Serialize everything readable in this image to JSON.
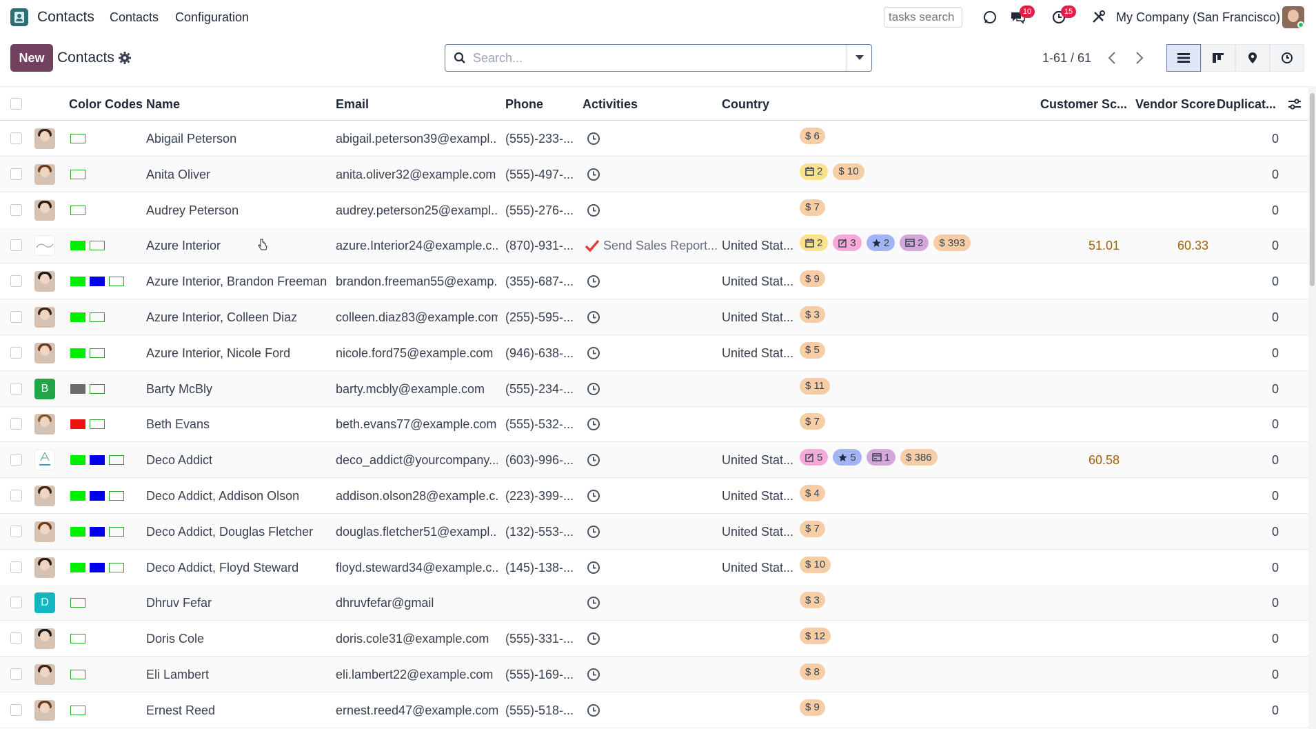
{
  "navbar": {
    "app_title": "Contacts",
    "menu": [
      "Contacts",
      "Configuration"
    ],
    "tasks_search_placeholder": "tasks search",
    "messages_badge": "10",
    "activities_badge": "15",
    "company": "My Company (San Francisco)"
  },
  "control_panel": {
    "new_label": "New",
    "breadcrumb": "Contacts",
    "search_placeholder": "Search...",
    "pager": "1-61 / 61"
  },
  "columns": {
    "color_codes": "Color Codes",
    "name": "Name",
    "email": "Email",
    "phone": "Phone",
    "activities": "Activities",
    "country": "Country",
    "customer_score": "Customer Sc...",
    "vendor_score": "Vendor Score",
    "duplicates": "Duplicat..."
  },
  "colors": {
    "green": "#00ee00",
    "blue": "#0000ee",
    "gray": "#6b6b6b",
    "red": "#ee1111",
    "brand": "#71415f",
    "tag_sales": "#f6cda4",
    "tag_meeting": "#fbe28a",
    "tag_task": "#f7a9d8",
    "tag_star": "#a3b4f5",
    "tag_invoice": "#d4a7d8"
  },
  "rows": [
    {
      "name": "Abigail Peterson",
      "email": "abigail.peterson39@exampl...",
      "phone": "(555)-233-...",
      "country": "",
      "activity": "",
      "swatches": [
        "empty"
      ],
      "avatar": "photo",
      "tags": [
        {
          "kind": "sales",
          "text": "$ 6"
        }
      ],
      "customer_score": "",
      "vendor_score": "",
      "duplicates": "0"
    },
    {
      "name": "Anita Oliver",
      "email": "anita.oliver32@example.com",
      "phone": "(555)-497-...",
      "country": "",
      "activity": "",
      "swatches": [
        "empty"
      ],
      "avatar": "photo",
      "tags": [
        {
          "kind": "meeting",
          "text": "2"
        },
        {
          "kind": "sales",
          "text": "$ 10"
        }
      ],
      "customer_score": "",
      "vendor_score": "",
      "duplicates": "0"
    },
    {
      "name": "Audrey Peterson",
      "email": "audrey.peterson25@exampl...",
      "phone": "(555)-276-...",
      "country": "",
      "activity": "",
      "swatches": [
        "empty"
      ],
      "avatar": "photo",
      "tags": [
        {
          "kind": "sales",
          "text": "$ 7"
        }
      ],
      "customer_score": "",
      "vendor_score": "",
      "duplicates": "0"
    },
    {
      "name": "Azure Interior",
      "email": "azure.Interior24@example.c...",
      "phone": "(870)-931-...",
      "country": "United Stat...",
      "activity": "Send Sales Report...",
      "swatches": [
        "green",
        "empty"
      ],
      "avatar": "logo-azure",
      "tags": [
        {
          "kind": "meeting",
          "text": "2"
        },
        {
          "kind": "task",
          "text": "3"
        },
        {
          "kind": "star",
          "text": "2"
        },
        {
          "kind": "invoice",
          "text": "2"
        },
        {
          "kind": "sales",
          "text": "$ 393"
        }
      ],
      "customer_score": "51.01",
      "vendor_score": "60.33",
      "duplicates": "0"
    },
    {
      "name": "Azure Interior, Brandon Freeman",
      "email": "brandon.freeman55@examp...",
      "phone": "(355)-687-...",
      "country": "United Stat...",
      "activity": "",
      "swatches": [
        "green",
        "blue",
        "empty"
      ],
      "avatar": "photo",
      "tags": [
        {
          "kind": "sales",
          "text": "$ 9"
        }
      ],
      "customer_score": "",
      "vendor_score": "",
      "duplicates": "0"
    },
    {
      "name": "Azure Interior, Colleen Diaz",
      "email": "colleen.diaz83@example.com",
      "phone": "(255)-595-...",
      "country": "United Stat...",
      "activity": "",
      "swatches": [
        "green",
        "empty"
      ],
      "avatar": "photo",
      "tags": [
        {
          "kind": "sales",
          "text": "$ 3"
        }
      ],
      "customer_score": "",
      "vendor_score": "",
      "duplicates": "0"
    },
    {
      "name": "Azure Interior, Nicole Ford",
      "email": "nicole.ford75@example.com",
      "phone": "(946)-638-...",
      "country": "United Stat...",
      "activity": "",
      "swatches": [
        "green",
        "empty"
      ],
      "avatar": "photo",
      "tags": [
        {
          "kind": "sales",
          "text": "$ 5"
        }
      ],
      "customer_score": "",
      "vendor_score": "",
      "duplicates": "0"
    },
    {
      "name": "Barty McBly",
      "email": "barty.mcbly@example.com",
      "phone": "(555)-234-...",
      "country": "",
      "activity": "",
      "swatches": [
        "gray",
        "empty"
      ],
      "avatar": "letter-B",
      "tags": [
        {
          "kind": "sales",
          "text": "$ 11"
        }
      ],
      "customer_score": "",
      "vendor_score": "",
      "duplicates": "0"
    },
    {
      "name": "Beth Evans",
      "email": "beth.evans77@example.com",
      "phone": "(555)-532-...",
      "country": "",
      "activity": "",
      "swatches": [
        "red",
        "empty"
      ],
      "avatar": "photo",
      "tags": [
        {
          "kind": "sales",
          "text": "$ 7"
        }
      ],
      "customer_score": "",
      "vendor_score": "",
      "duplicates": "0"
    },
    {
      "name": "Deco Addict",
      "email": "deco_addict@yourcompany....",
      "phone": "(603)-996-...",
      "country": "United Stat...",
      "activity": "",
      "swatches": [
        "green",
        "blue",
        "empty"
      ],
      "avatar": "logo-deco",
      "tags": [
        {
          "kind": "task",
          "text": "5"
        },
        {
          "kind": "star",
          "text": "5"
        },
        {
          "kind": "invoice",
          "text": "1"
        },
        {
          "kind": "sales",
          "text": "$ 386"
        }
      ],
      "customer_score": "60.58",
      "vendor_score": "",
      "duplicates": "0"
    },
    {
      "name": "Deco Addict, Addison Olson",
      "email": "addison.olson28@example.c...",
      "phone": "(223)-399-...",
      "country": "United Stat...",
      "activity": "",
      "swatches": [
        "green",
        "blue",
        "empty"
      ],
      "avatar": "photo",
      "tags": [
        {
          "kind": "sales",
          "text": "$ 4"
        }
      ],
      "customer_score": "",
      "vendor_score": "",
      "duplicates": "0"
    },
    {
      "name": "Deco Addict, Douglas Fletcher",
      "email": "douglas.fletcher51@exampl...",
      "phone": "(132)-553-...",
      "country": "United Stat...",
      "activity": "",
      "swatches": [
        "green",
        "blue",
        "empty"
      ],
      "avatar": "photo",
      "tags": [
        {
          "kind": "sales",
          "text": "$ 7"
        }
      ],
      "customer_score": "",
      "vendor_score": "",
      "duplicates": "0"
    },
    {
      "name": "Deco Addict, Floyd Steward",
      "email": "floyd.steward34@example.c...",
      "phone": "(145)-138-...",
      "country": "United Stat...",
      "activity": "",
      "swatches": [
        "green",
        "blue",
        "empty"
      ],
      "avatar": "photo",
      "tags": [
        {
          "kind": "sales",
          "text": "$ 10"
        }
      ],
      "customer_score": "",
      "vendor_score": "",
      "duplicates": "0"
    },
    {
      "name": "Dhruv Fefar",
      "email": "dhruvfefar@gmail",
      "phone": "",
      "country": "",
      "activity": "",
      "swatches": [
        "empty"
      ],
      "avatar": "letter-D",
      "tags": [
        {
          "kind": "sales",
          "text": "$ 3"
        }
      ],
      "customer_score": "",
      "vendor_score": "",
      "duplicates": "0"
    },
    {
      "name": "Doris Cole",
      "email": "doris.cole31@example.com",
      "phone": "(555)-331-...",
      "country": "",
      "activity": "",
      "swatches": [
        "empty"
      ],
      "avatar": "photo",
      "tags": [
        {
          "kind": "sales",
          "text": "$ 12"
        }
      ],
      "customer_score": "",
      "vendor_score": "",
      "duplicates": "0"
    },
    {
      "name": "Eli Lambert",
      "email": "eli.lambert22@example.com",
      "phone": "(555)-169-...",
      "country": "",
      "activity": "",
      "swatches": [
        "empty"
      ],
      "avatar": "photo",
      "tags": [
        {
          "kind": "sales",
          "text": "$ 8"
        }
      ],
      "customer_score": "",
      "vendor_score": "",
      "duplicates": "0"
    },
    {
      "name": "Ernest Reed",
      "email": "ernest.reed47@example.com",
      "phone": "(555)-518-...",
      "country": "",
      "activity": "",
      "swatches": [
        "empty"
      ],
      "avatar": "photo",
      "tags": [
        {
          "kind": "sales",
          "text": "$ 9"
        }
      ],
      "customer_score": "",
      "vendor_score": "",
      "duplicates": "0"
    }
  ]
}
